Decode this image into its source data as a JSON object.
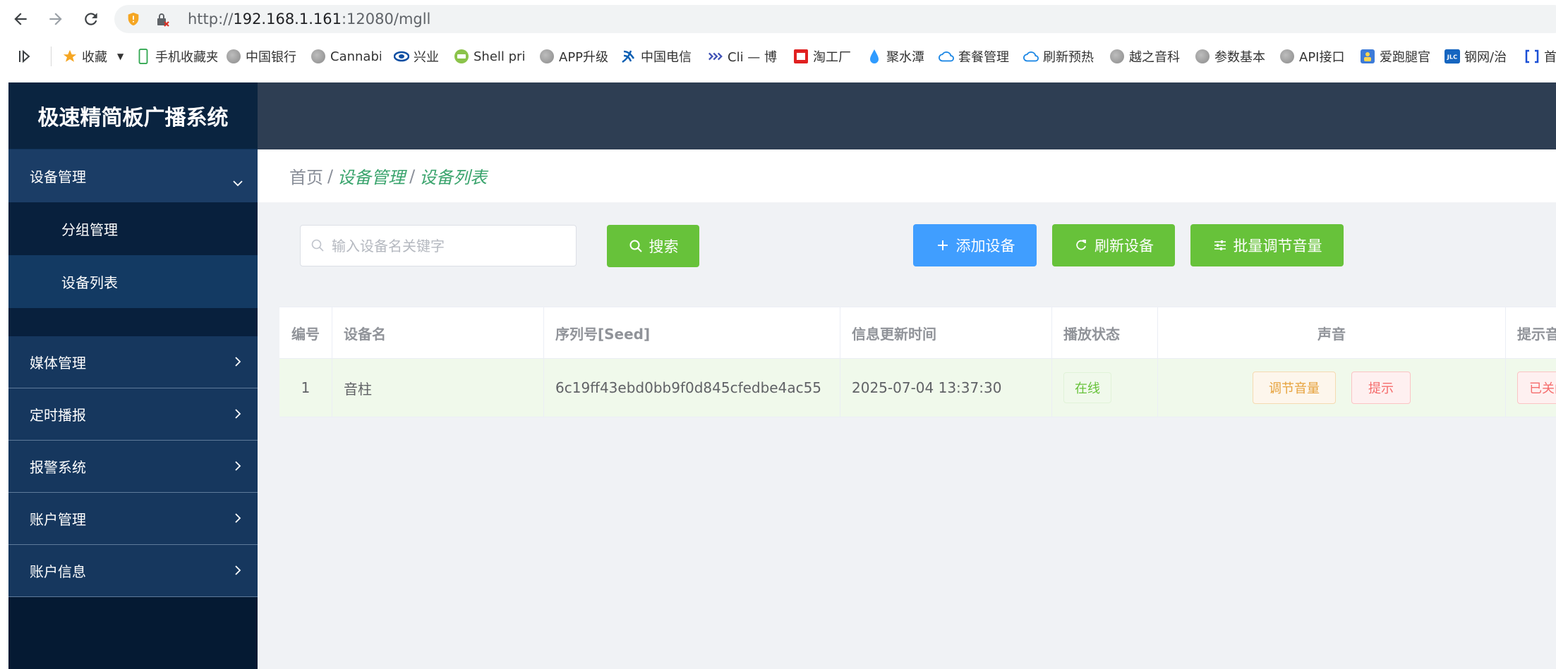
{
  "browser": {
    "url_scheme": "http://",
    "url_host": "192.168.1.161",
    "url_rest": ":12080/mgll",
    "bookmarks": [
      {
        "label": "收藏",
        "icon": "star-icon"
      },
      {
        "label": "手机收藏夹",
        "icon": "phone-icon"
      },
      {
        "label": "中国银行",
        "icon": "globe-icon"
      },
      {
        "label": "Cannabi",
        "icon": "globe-icon"
      },
      {
        "label": "兴业",
        "icon": "bank-icon"
      },
      {
        "label": "Shell pri",
        "icon": "shell-icon"
      },
      {
        "label": "APP升级",
        "icon": "globe-icon"
      },
      {
        "label": "中国电信",
        "icon": "telecom-icon"
      },
      {
        "label": "Cli — 博",
        "icon": "cli-icon"
      },
      {
        "label": "淘工厂",
        "icon": "factory-icon"
      },
      {
        "label": "聚水潭",
        "icon": "water-icon"
      },
      {
        "label": "套餐管理",
        "icon": "cloud-icon"
      },
      {
        "label": "刷新预热",
        "icon": "cloud-icon"
      },
      {
        "label": "越之音科",
        "icon": "globe-icon"
      },
      {
        "label": "参数基本",
        "icon": "globe-icon"
      },
      {
        "label": "API接口",
        "icon": "globe-icon"
      },
      {
        "label": "爱跑腿官",
        "icon": "runner-icon"
      },
      {
        "label": "钢网/治",
        "icon": "jlc-icon"
      },
      {
        "label": "首",
        "icon": "bracket-icon"
      }
    ]
  },
  "sidebar": {
    "title": "极速精简板广播系统",
    "groups": [
      {
        "label": "设备管理"
      },
      {
        "label": "媒体管理"
      },
      {
        "label": "定时播报"
      },
      {
        "label": "报警系统"
      },
      {
        "label": "账户管理"
      },
      {
        "label": "账户信息"
      }
    ],
    "sub_items": [
      {
        "label": "分组管理"
      },
      {
        "label": "设备列表"
      }
    ]
  },
  "breadcrumb": {
    "home": "首页",
    "sep": "/",
    "level1": "设备管理",
    "level2": "设备列表"
  },
  "toolbar": {
    "search_placeholder": "输入设备名关键字",
    "search_label": "搜索",
    "add_label": "添加设备",
    "refresh_label": "刷新设备",
    "batch_label": "批量调节音量"
  },
  "table": {
    "headers": [
      "编号",
      "设备名",
      "序列号[Seed]",
      "信息更新时间",
      "播放状态",
      "声音",
      "提示音"
    ],
    "rows": [
      {
        "num": "1",
        "name": "音柱",
        "seed": "6c19ff43ebd0bb9f0d845cfedbe4ac55",
        "time": "2025-07-04 13:37:30",
        "state": "在线",
        "volume_btn": "调节音量",
        "hint_btn": "提示",
        "tip_status": "已关闭"
      }
    ]
  },
  "colors": {
    "sidebar_bg": "#051a33",
    "topbar_bg": "#2e3e53",
    "primary": "#409eff",
    "success": "#67c23a",
    "breadcrumb_active": "#3aa46d"
  }
}
